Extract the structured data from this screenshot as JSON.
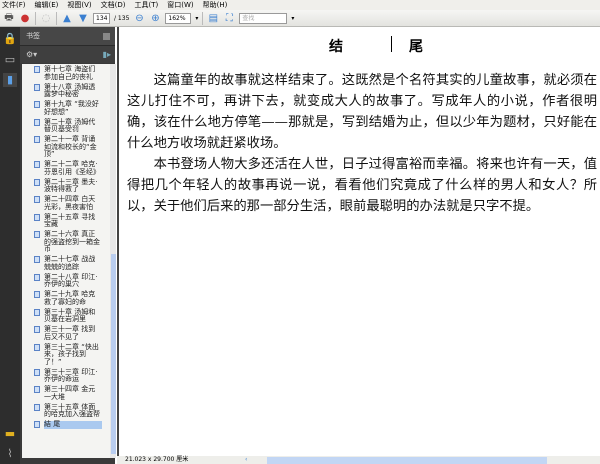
{
  "menu": [
    "文件(F)",
    "编辑(E)",
    "视图(V)",
    "文档(D)",
    "工具(T)",
    "窗口(W)",
    "帮助(H)"
  ],
  "toolbar": {
    "page_current": "134",
    "page_total": "/ 135",
    "zoom": "162%",
    "search_placeholder": "查找"
  },
  "panel": {
    "title": "书签"
  },
  "bookmarks": [
    "第十七章 海盗们参加自己的丧礼",
    "第十八章 汤姆透露梦中秘密",
    "第十九章 “我没好好想想”",
    "第二十章 汤姆代替贝基受罚",
    "第二十一章 背诵如流和校长的“金顶”",
    "第二十二章 哈克·芬恩引用《圣经》",
    "第二十三章 墨夫·波特得救了",
    "第二十四章 白天光彩，黑夜害怕",
    "第二十五章 寻找宝藏",
    "第二十六章 真正的强盗挖到一箱金币",
    "第二十七章 战战兢兢的追踪",
    "第二十八章 印江·乔伊的巢穴",
    "第二十九章 哈克救了寡妇的命",
    "第三十章 汤姆和贝基在岩洞里",
    "第三十一章 找到后又不见了",
    "第三十二章 “快出来，孩子找到了！”",
    "第三十三章 印江·乔伊的命运",
    "第三十四章 金元一大堆",
    "第三十五章 体面的哈克加入强盗帮",
    "結 尾"
  ],
  "document": {
    "title": "结　尾",
    "paragraphs": [
      "这篇童年的故事就这样结束了。这既然是个名符其实的儿童故事，就必须在这儿打住不可，再讲下去，就变成大人的故事了。写成年人的小说，作者很明确，该在什么地方停笔——那就是，写到结婚为止，但以少年为题材，只好能在什么地方收场就赶紧收场。",
      "本书登场人物大多还活在人世，日子过得富裕而幸福。将来也许有一天，值得把几个年轻人的故事再说一说，看看他们究竟成了什么样的男人和女人？所以，关于他们后来的那一部分生活，眼前最聪明的办法就是只字不提。"
    ]
  },
  "status": {
    "page_size": "21.023 x 29.700 厘米"
  }
}
